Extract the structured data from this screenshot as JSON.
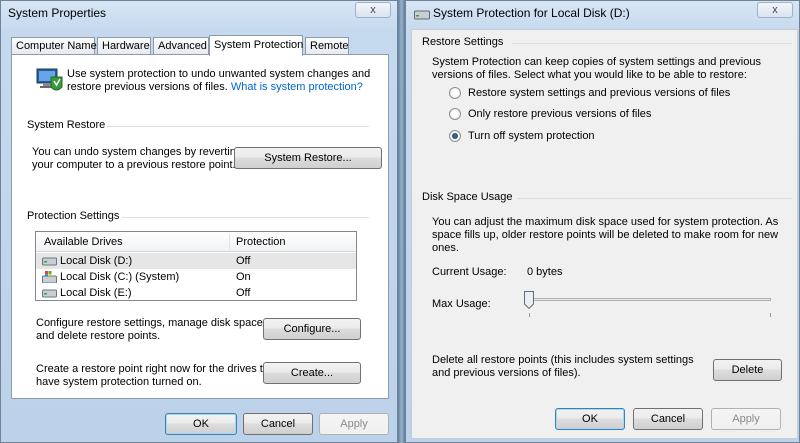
{
  "left_window": {
    "title": "System Properties",
    "close_label": "x",
    "tabs": [
      "Computer Name",
      "Hardware",
      "Advanced",
      "System Protection",
      "Remote"
    ],
    "intro_line1": "Use system protection to undo unwanted system changes and",
    "intro_line2": "restore previous versions of files.",
    "intro_link": "What is system protection?",
    "restore_group": "System Restore",
    "restore_line1": "You can undo system changes by reverting",
    "restore_line2": "your computer to a previous restore point.",
    "restore_button": "System Restore...",
    "protection_group": "Protection Settings",
    "drives_header": {
      "col1": "Available Drives",
      "col2": "Protection"
    },
    "drives": [
      {
        "name": "Local Disk (D:)",
        "protection": "Off",
        "icon": "hard-drive-icon"
      },
      {
        "name": "Local Disk (C:) (System)",
        "protection": "On",
        "icon": "system-drive-icon"
      },
      {
        "name": "Local Disk (E:)",
        "protection": "Off",
        "icon": "hard-drive-icon"
      }
    ],
    "configure_line1": "Configure restore settings, manage disk space,",
    "configure_line2": "and delete restore points.",
    "configure_button": "Configure...",
    "create_line1": "Create a restore point right now for the drives that",
    "create_line2": "have system protection turned on.",
    "create_button": "Create...",
    "ok": "OK",
    "cancel": "Cancel",
    "apply": "Apply"
  },
  "right_window": {
    "title": "System Protection for Local Disk (D:)",
    "close_label": "x",
    "restore_group": "Restore Settings",
    "restore_line1": "System Protection can keep copies of system settings and previous",
    "restore_line2": "versions of files. Select what you would like to be able to restore:",
    "options": [
      "Restore system settings and previous versions of files",
      "Only restore previous versions of files",
      "Turn off system protection"
    ],
    "selected_option": 2,
    "disk_group": "Disk Space Usage",
    "disk_line1": "You can adjust the maximum disk space used for system protection. As",
    "disk_line2": "space fills up, older restore points will be deleted to make room for new",
    "disk_line3": "ones.",
    "current_usage_label": "Current Usage:",
    "current_usage_value": "0 bytes",
    "max_usage_label": "Max Usage:",
    "max_usage_fraction": 0,
    "delete_line1": "Delete all restore points (this includes system settings",
    "delete_line2": "and previous versions of files).",
    "delete_button": "Delete",
    "ok": "OK",
    "cancel": "Cancel",
    "apply": "Apply"
  }
}
